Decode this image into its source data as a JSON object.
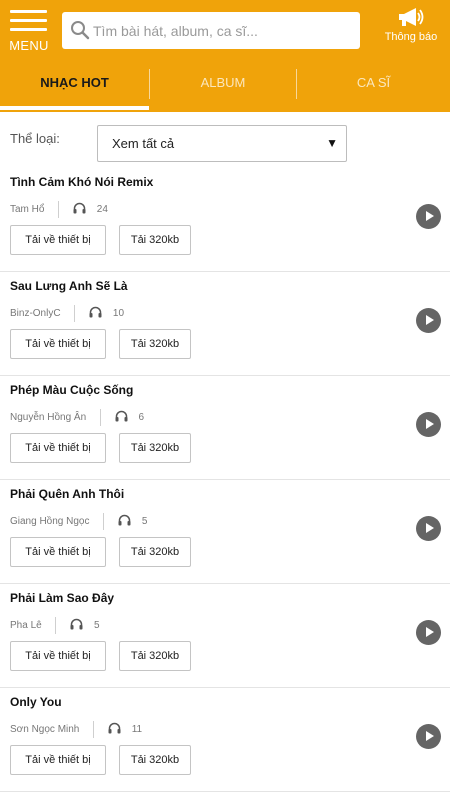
{
  "header": {
    "menu_label": "MENU",
    "search_placeholder": "Tìm bài hát, album, ca sĩ...",
    "notify_label": "Thông báo",
    "bg_color": "#f0a30a"
  },
  "tabs": [
    {
      "label": "NHẠC HOT",
      "active": true
    },
    {
      "label": "ALBUM",
      "active": false
    },
    {
      "label": "CA SĨ",
      "active": false
    }
  ],
  "filter": {
    "label": "Thể loại:",
    "selected": "Xem tất cả"
  },
  "song_buttons": {
    "download_device": "Tải về thiết bị",
    "download_hq": "Tải 320kb"
  },
  "songs": [
    {
      "title": "Tình Cảm Khó Nói Remix",
      "artist": "Tam Hổ",
      "listens": "24"
    },
    {
      "title": "Sau Lưng Anh Sẽ Là",
      "artist": "Binz-OnlyC",
      "listens": "10"
    },
    {
      "title": "Phép Màu Cuộc Sống",
      "artist": "Nguyễn Hồng Ân",
      "listens": "6"
    },
    {
      "title": "Phải Quên Anh Thôi",
      "artist": "Giang Hồng Ngọc",
      "listens": "5"
    },
    {
      "title": "Phải Làm Sao Đây",
      "artist": "Pha Lê",
      "listens": "5"
    },
    {
      "title": "Only You",
      "artist": "Sơn Ngọc Minh",
      "listens": "11"
    }
  ]
}
